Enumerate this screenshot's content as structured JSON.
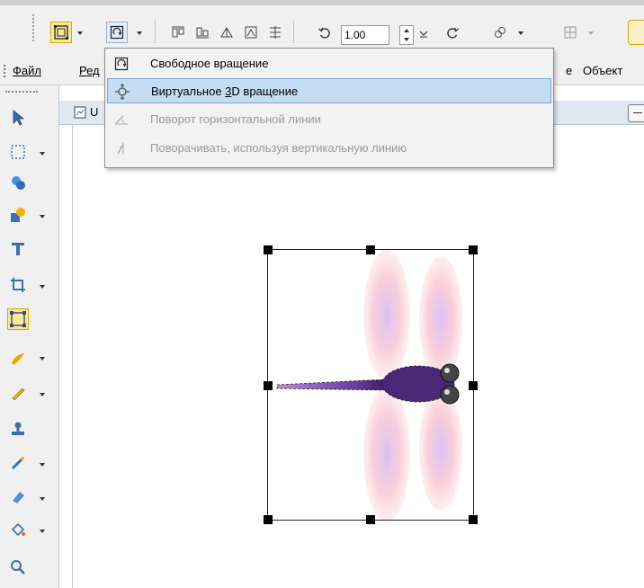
{
  "toolbar": {
    "zoom_value": "1.00",
    "buttons": [
      {
        "icon": "transform-pick-icon",
        "active": true
      },
      {
        "icon": "free-rotate-icon"
      },
      {
        "icon": "align-top-icon"
      },
      {
        "icon": "align-bottom-icon"
      },
      {
        "icon": "flip-icon"
      },
      {
        "icon": "mirror-icon"
      },
      {
        "icon": "distribute-icon"
      },
      {
        "icon": "rotate-ccw-icon"
      },
      {
        "icon": "rotate-cw-icon"
      },
      {
        "icon": "link-icon"
      },
      {
        "icon": "grid-icon"
      }
    ]
  },
  "menubar": {
    "items": [
      "Файл",
      "Ред",
      "е",
      "Объект"
    ]
  },
  "document": {
    "tab_initial": "U"
  },
  "dropdown": {
    "items": [
      {
        "label": "Свободное вращение",
        "icon": "free-rotate-icon",
        "enabled": true,
        "highlighted": false
      },
      {
        "label_pre": "Виртуальное ",
        "label_accel": "3",
        "label_post": "D вращение",
        "icon": "virtual-3d-rotate-icon",
        "enabled": true,
        "highlighted": true
      },
      {
        "label": "Поворот горизонтальной линии",
        "icon": "horizontal-line-rotate-icon",
        "enabled": false,
        "highlighted": false
      },
      {
        "label": "Поворачивать, используя вертикальную линию",
        "icon": "vertical-line-rotate-icon",
        "enabled": false,
        "highlighted": false
      }
    ]
  },
  "colors": {
    "active_tool_bg": "#fbe89a",
    "menu_highlight": "#c5dcf5",
    "dragonfly_body": "#5b2e8a",
    "wing_tint": "#f7b9c8"
  }
}
